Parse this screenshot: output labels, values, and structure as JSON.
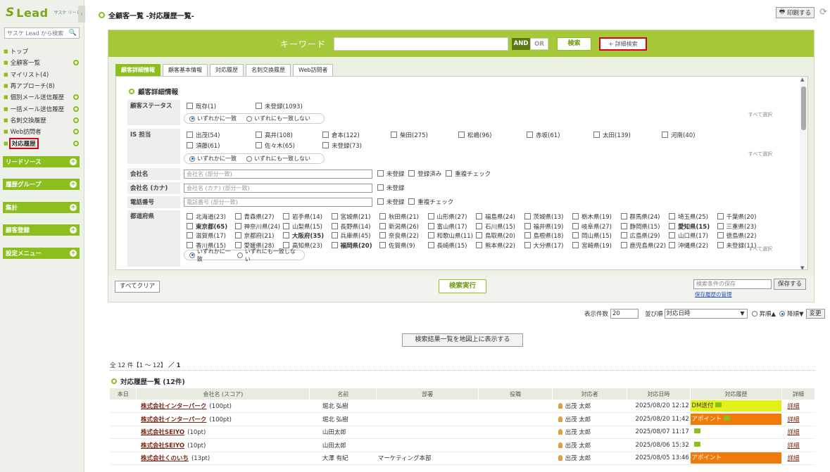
{
  "sidebar": {
    "logo_text": "Lead",
    "logo_sub": "サスケ リード",
    "search_placeholder": "サスケ Lead から検索",
    "items": [
      {
        "label": "トップ",
        "plus": false
      },
      {
        "label": "全顧客一覧",
        "plus": true
      },
      {
        "label": "マイリスト(4)",
        "plus": false
      },
      {
        "label": "再アプローチ(8)",
        "plus": false
      },
      {
        "label": "個別メール送信履歴",
        "plus": true
      },
      {
        "label": "一括メール送信履歴",
        "plus": true
      },
      {
        "label": "名刺交換履歴",
        "plus": true
      },
      {
        "label": "Web訪問者",
        "plus": true
      },
      {
        "label": "対応履歴",
        "plus": true
      }
    ],
    "sections": [
      "リードソース",
      "履歴グループ",
      "集計",
      "顧客登録",
      "設定メニュー"
    ]
  },
  "header": {
    "breadcrumb": "全顧客一覧 -対応履歴一覧-",
    "print_label": "印刷する"
  },
  "keyword": {
    "label": "キーワード",
    "and_label": "AND",
    "or_label": "OR",
    "search_label": "検索",
    "advanced_label": "+ 詳細検索"
  },
  "tabs": [
    "顧客詳細情報",
    "顧客基本情報",
    "対応履歴",
    "名刺交換履歴",
    "Web訪問者"
  ],
  "panel": {
    "title": "顧客詳細情報",
    "select_all": "すべて選択",
    "match_any": "いずれかに一致",
    "match_none": "いずれにも一致しない",
    "status": {
      "label": "顧客ステータス",
      "options": [
        "既存(1)",
        "未登録(1093)"
      ]
    },
    "is": {
      "label": "IS 担当",
      "options": [
        "出茂(54)",
        "高井(108)",
        "倉本(122)",
        "柴田(275)",
        "松嶋(96)",
        "赤坂(61)",
        "太田(139)",
        "河南(40)",
        "須藤(61)",
        "佐々木(65)",
        "未登録(73)"
      ]
    },
    "company": {
      "label": "会社名",
      "placeholder": "会社名 (部分一致)",
      "options": [
        "未登録",
        "登録済み",
        "重複チェック"
      ]
    },
    "company_kana": {
      "label": "会社名 (カナ)",
      "placeholder": "会社名 (カナ) (部分一致)",
      "options": [
        "未登録"
      ]
    },
    "phone": {
      "label": "電話番号",
      "placeholder": "電話番号 (部分一致)",
      "options": [
        "未登録",
        "重複チェック"
      ]
    },
    "pref": {
      "label": "都道府県",
      "rows": [
        [
          "北海道(23)",
          "青森県(27)",
          "岩手県(14)",
          "宮城県(21)",
          "秋田県(21)",
          "山形県(27)",
          "福島県(24)",
          "茨城県(13)",
          "栃木県(19)",
          "群馬県(24)",
          "埼玉県(25)",
          "千葉県(20)"
        ],
        [
          "東京都(65)",
          "神奈川県(24)",
          "山梨県(15)",
          "長野県(14)",
          "新潟県(26)",
          "富山県(17)",
          "石川県(15)",
          "福井県(19)",
          "岐阜県(27)",
          "静岡県(15)",
          "愛知県(15)",
          "三重県(23)"
        ],
        [
          "滋賀県(17)",
          "京都府(21)",
          "大阪府(35)",
          "兵庫県(45)",
          "奈良県(22)",
          "和歌山県(11)",
          "鳥取県(20)",
          "島根県(18)",
          "岡山県(15)",
          "広島県(29)",
          "山口県(17)",
          "徳島県(22)"
        ],
        [
          "香川県(15)",
          "愛媛県(28)",
          "高知県(23)",
          "福岡県(20)",
          "佐賀県(9)",
          "長崎県(15)",
          "熊本県(22)",
          "大分県(17)",
          "宮崎県(19)",
          "鹿児島県(22)",
          "沖縄県(22)",
          "未登録(11)"
        ]
      ],
      "bold": [
        "東京都(65)",
        "大阪府(35)",
        "福岡県(20)",
        "愛知県(15)"
      ]
    }
  },
  "footer": {
    "clear_label": "すべてクリア",
    "exec_label": "検索実行",
    "save_placeholder": "検索条件の保存",
    "save_label": "保存する",
    "manage_link": "保存履歴の管理"
  },
  "controls": {
    "count_label": "表示件数",
    "count_value": "20",
    "sort_label": "並び順",
    "sort_value": "対応日時",
    "asc_label": "昇順▲",
    "desc_label": "降順▼",
    "change_label": "変更"
  },
  "map_button": "検索結果一覧を地図上に表示する",
  "results": {
    "count_text": "全 12 件【1 ～ 12】",
    "page_text": "／ 1",
    "title": "対応履歴一覧 (12件)",
    "columns": [
      "本日",
      "会社名 (スコア)",
      "名前",
      "部署",
      "役職",
      "対応者",
      "対応日時",
      "対応履歴",
      "詳細"
    ],
    "rows": [
      {
        "company": "株式会社インターパーク",
        "score": "(100pt)",
        "name": "堀北 弘樹",
        "dept": "",
        "staff": "出茂 太郎",
        "date": "2025/08/20 12:12",
        "hist": "DM送付",
        "hist_type": "dm",
        "memo": true,
        "detail": "詳細"
      },
      {
        "company": "株式会社インターパーク",
        "score": "(100pt)",
        "name": "堀北 弘樹",
        "dept": "",
        "staff": "出茂 太郎",
        "date": "2025/08/20 11:42",
        "hist": "アポイント",
        "hist_type": "ap",
        "memo": true,
        "detail": "詳細"
      },
      {
        "company": "株式会社SEIYO",
        "score": "(10pt)",
        "name": "山田太郎",
        "dept": "",
        "staff": "出茂 太郎",
        "date": "2025/08/07 11:17",
        "hist": "",
        "hist_type": "none",
        "memo": true,
        "detail": "詳細"
      },
      {
        "company": "株式会社SEIYO",
        "score": "(10pt)",
        "name": "山田太郎",
        "dept": "",
        "staff": "出茂 太郎",
        "date": "2025/08/06 15:32",
        "hist": "",
        "hist_type": "none",
        "memo": true,
        "detail": "詳細"
      },
      {
        "company": "株式会社くのいち",
        "score": "(13pt)",
        "name": "大澤 有紀",
        "dept": "マーケティング本部",
        "staff": "出茂 太郎",
        "date": "2025/08/05 13:46",
        "hist": "アポイント",
        "hist_type": "ap",
        "memo": false,
        "detail": "詳細"
      }
    ]
  }
}
